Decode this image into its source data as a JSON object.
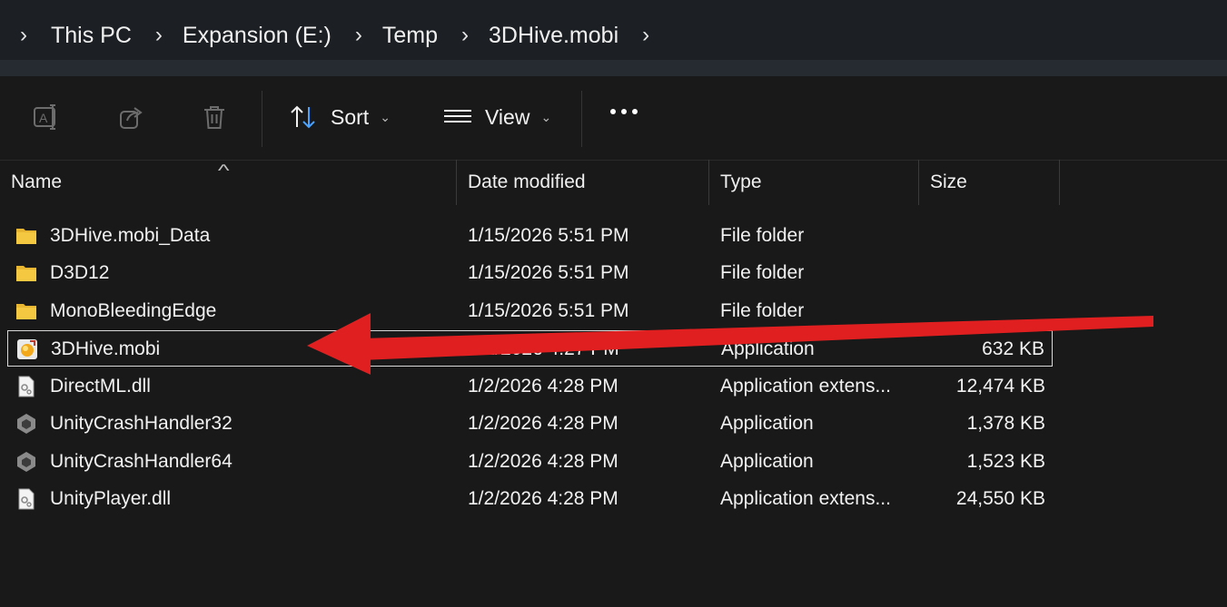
{
  "breadcrumb": {
    "segments": [
      "This PC",
      "Expansion (E:)",
      "Temp",
      "3DHive.mobi"
    ]
  },
  "commandbar": {
    "sort_label": "Sort",
    "view_label": "View"
  },
  "columns": {
    "name": "Name",
    "date": "Date modified",
    "type": "Type",
    "size": "Size"
  },
  "files": [
    {
      "name": "3DHive.mobi_Data",
      "date": "1/15/2026 5:51 PM",
      "type": "File folder",
      "size": "",
      "icon": "folder-icon"
    },
    {
      "name": "D3D12",
      "date": "1/15/2026 5:51 PM",
      "type": "File folder",
      "size": "",
      "icon": "folder-icon"
    },
    {
      "name": "MonoBleedingEdge",
      "date": "1/15/2026 5:51 PM",
      "type": "File folder",
      "size": "",
      "icon": "folder-icon"
    },
    {
      "name": "3DHive.mobi",
      "date": "1/2/2026 4:27 PM",
      "type": "Application",
      "size": "632 KB",
      "icon": "app-icon"
    },
    {
      "name": "DirectML.dll",
      "date": "1/2/2026 4:28 PM",
      "type": "Application extens...",
      "size": "12,474 KB",
      "icon": "dll-icon"
    },
    {
      "name": "UnityCrashHandler32",
      "date": "1/2/2026 4:28 PM",
      "type": "Application",
      "size": "1,378 KB",
      "icon": "unity-icon"
    },
    {
      "name": "UnityCrashHandler64",
      "date": "1/2/2026 4:28 PM",
      "type": "Application",
      "size": "1,523 KB",
      "icon": "unity-icon"
    },
    {
      "name": "UnityPlayer.dll",
      "date": "1/2/2026 4:28 PM",
      "type": "Application extens...",
      "size": "24,550 KB",
      "icon": "dll-icon"
    }
  ],
  "colors": {
    "folder": "#f0c040",
    "arrow": "#e02020",
    "background": "#191919"
  }
}
